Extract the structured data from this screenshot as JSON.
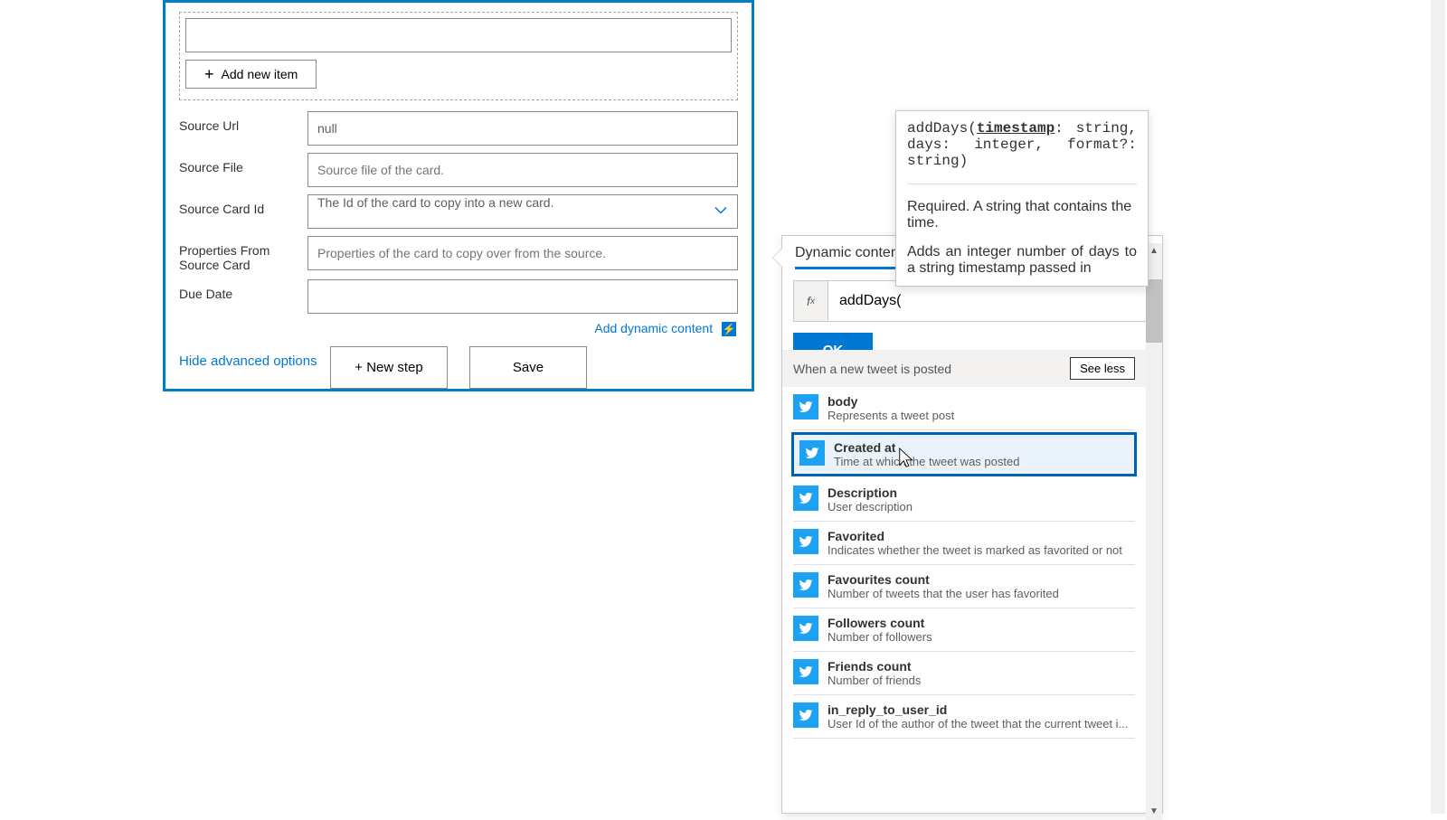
{
  "card": {
    "add_item": "Add new item",
    "rows": {
      "source_url": {
        "label": "Source Url",
        "value": "null"
      },
      "source_file": {
        "label": "Source File",
        "placeholder": "Source file of the card."
      },
      "source_card_id": {
        "label": "Source Card Id",
        "placeholder": "The Id of the card to copy into a new card."
      },
      "props": {
        "label": "Properties From Source Card",
        "placeholder": "Properties of the card to copy over from the source."
      },
      "due_date": {
        "label": "Due Date",
        "value": ""
      }
    },
    "add_dynamic": "Add dynamic content",
    "advanced": "Hide advanced options"
  },
  "buttons": {
    "new_step": "+ New step",
    "save": "Save"
  },
  "panel": {
    "title": "Dynamic content",
    "fx": "addDays(",
    "ok": "OK",
    "section": "When a new tweet is posted",
    "see_less": "See less",
    "tokens": [
      {
        "title": "body",
        "desc": "Represents a tweet post",
        "selected": false
      },
      {
        "title": "Created at",
        "desc": "Time at which the tweet was posted",
        "selected": true
      },
      {
        "title": "Description",
        "desc": "User description",
        "selected": false
      },
      {
        "title": "Favorited",
        "desc": "Indicates whether the tweet is marked as favorited or not",
        "selected": false
      },
      {
        "title": "Favourites count",
        "desc": "Number of tweets that the user has favorited",
        "selected": false
      },
      {
        "title": "Followers count",
        "desc": "Number of followers",
        "selected": false
      },
      {
        "title": "Friends count",
        "desc": "Number of friends",
        "selected": false
      },
      {
        "title": "in_reply_to_user_id",
        "desc": "User Id of the author of the tweet that the current tweet i...",
        "selected": false
      }
    ]
  },
  "tooltip": {
    "sig1_a": "addDays(",
    "sig1_b": "timestamp",
    "sig1_c": ": string, days: integer, format?: string)",
    "req": "Required. A string that contains the time.",
    "desc": "Adds an integer number of days to a string timestamp passed in"
  }
}
